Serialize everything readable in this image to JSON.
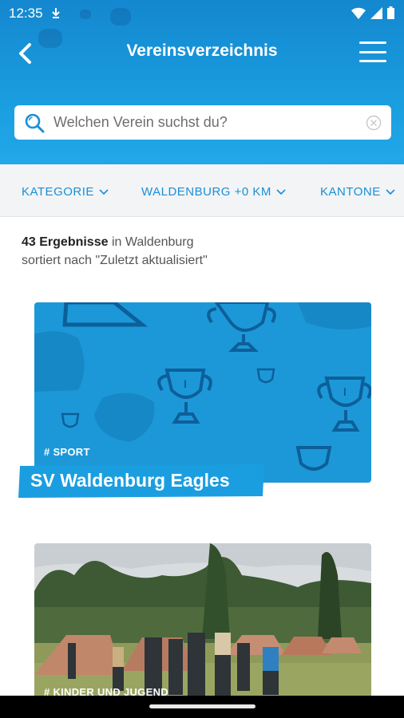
{
  "status_bar": {
    "time": "12:35",
    "notif_icon": "download-icon"
  },
  "header": {
    "title": "Vereinsverzeichnis",
    "back_icon": "back-arrow-icon",
    "menu_icon": "hamburger-menu-icon"
  },
  "search": {
    "placeholder": "Welchen Verein suchst du?",
    "value": ""
  },
  "filters": [
    {
      "label": "KATEGORIE"
    },
    {
      "label": "WALDENBURG +0 KM"
    },
    {
      "label": "KANTONE"
    }
  ],
  "results": {
    "count": "43 Ergebnisse",
    "location_text": "in Waldenburg",
    "sort_text": "sortiert nach \"Zuletzt aktualisiert\""
  },
  "cards": [
    {
      "tag": "# SPORT",
      "title": "SV Waldenburg Eagles"
    },
    {
      "tag": "# KINDER UND JUGEND"
    }
  ],
  "colors": {
    "accent": "#1a9ee0",
    "filter_text": "#1a8fd6",
    "card_bg": "#1c98d8"
  }
}
